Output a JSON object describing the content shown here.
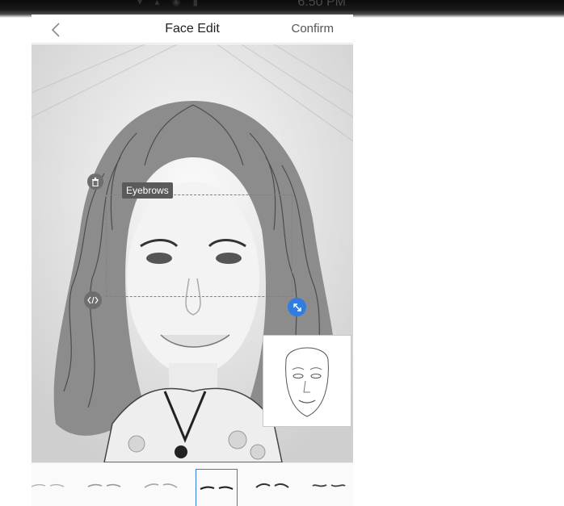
{
  "status_bar": {
    "time": "6:50 PM"
  },
  "header": {
    "back_icon": "chevron-left-icon",
    "title": "Face Edit",
    "confirm_label": "Confirm"
  },
  "editor": {
    "selection_label": "Eyebrows",
    "handles": {
      "delete": "trash-icon",
      "flip": "code-brackets-icon",
      "resize": "resize-arrows-icon"
    },
    "accent_color": "#2f7de1"
  },
  "brow_tray": {
    "items": [
      {
        "name": "brow-style-1",
        "selected": false
      },
      {
        "name": "brow-style-2",
        "selected": false
      },
      {
        "name": "brow-style-3",
        "selected": false
      },
      {
        "name": "brow-style-4",
        "selected": true
      },
      {
        "name": "brow-style-5",
        "selected": false
      },
      {
        "name": "brow-style-6",
        "selected": false
      }
    ]
  }
}
